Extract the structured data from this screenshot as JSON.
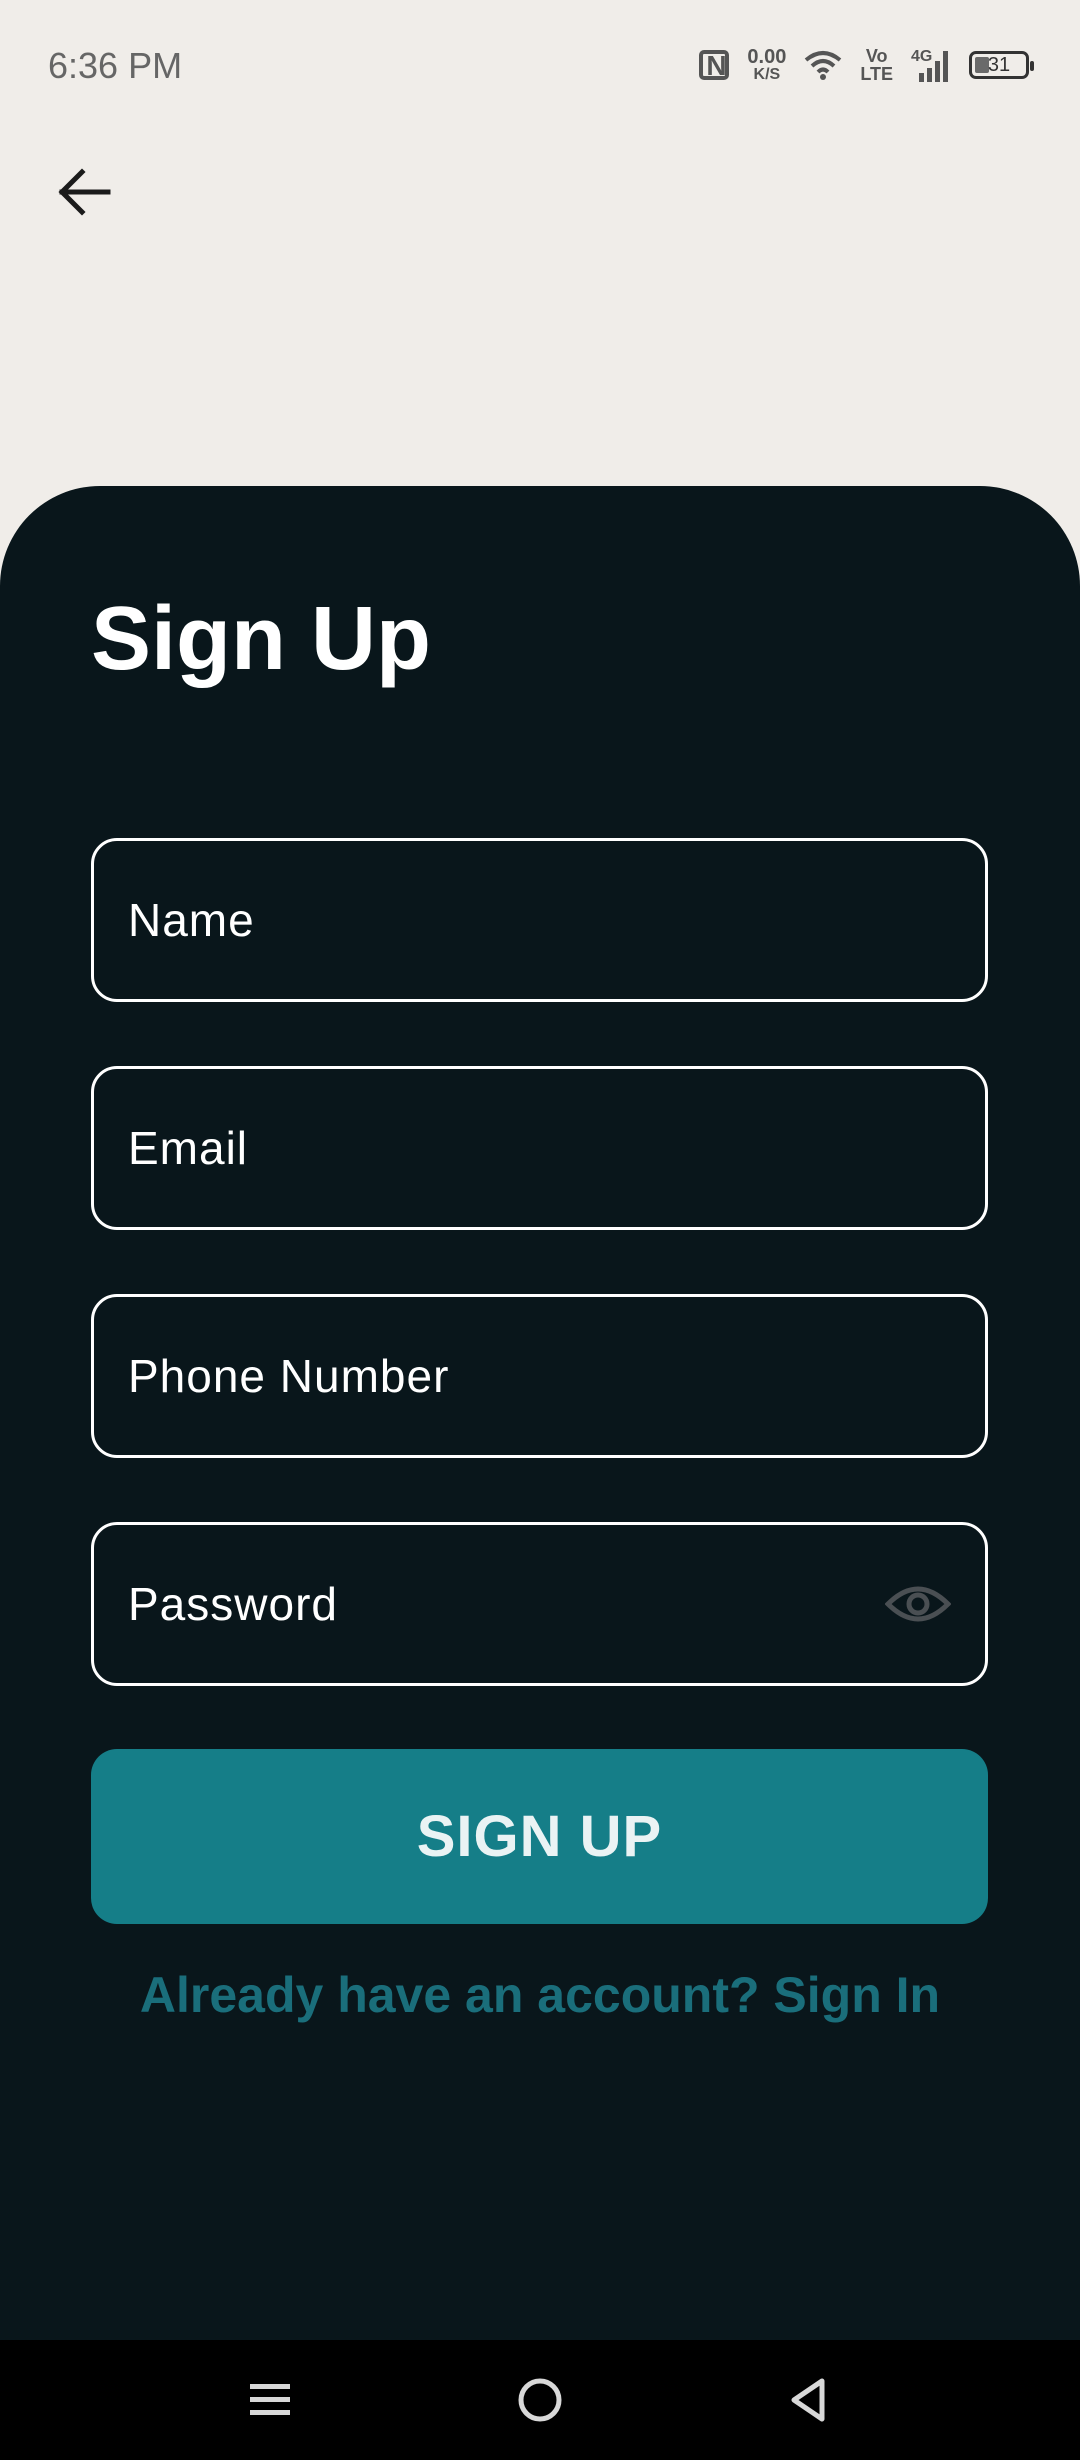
{
  "status_bar": {
    "time": "6:36 PM",
    "net_speed_value": "0.00",
    "net_speed_unit": "K/S",
    "volte_top": "Vo",
    "volte_bottom": "LTE",
    "network_type": "4G",
    "battery_level": "31"
  },
  "icons": {
    "back": "arrow-left-icon",
    "visibility": "eye-icon",
    "nav_menu": "menu-icon",
    "nav_home": "home-circle-icon",
    "nav_back": "triangle-back-icon"
  },
  "form": {
    "title": "Sign Up",
    "name_placeholder": "Name",
    "email_placeholder": "Email",
    "phone_placeholder": "Phone Number",
    "password_placeholder": "Password",
    "submit_label": "SIGN UP",
    "signin_link": "Already have an account? Sign In"
  },
  "colors": {
    "background": "#f0ede9",
    "sheet": "#09161b",
    "accent": "#157e88",
    "link": "#1a6e7b"
  }
}
